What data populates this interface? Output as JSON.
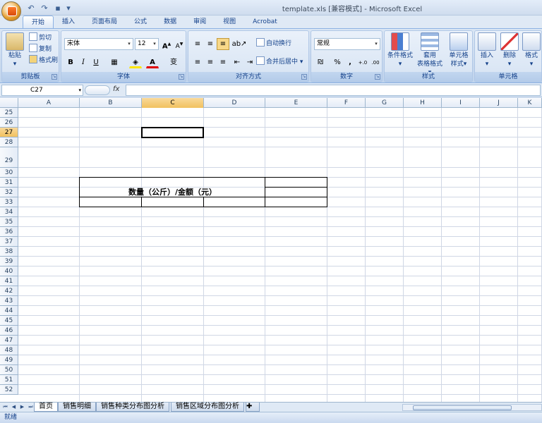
{
  "window": {
    "title": "template.xls  [兼容模式] - Microsoft Excel"
  },
  "qat": {
    "undo_icon": "undo-icon",
    "redo_icon": "redo-icon",
    "save_icon": "save-icon"
  },
  "tabs": [
    {
      "label": "开始",
      "active": true
    },
    {
      "label": "插入"
    },
    {
      "label": "页面布局"
    },
    {
      "label": "公式"
    },
    {
      "label": "数据"
    },
    {
      "label": "审阅"
    },
    {
      "label": "视图"
    },
    {
      "label": "Acrobat"
    }
  ],
  "ribbon": {
    "clipboard": {
      "label": "剪贴板",
      "paste": "粘贴",
      "cut": "剪切",
      "copy": "复制",
      "format_painter": "格式刷"
    },
    "font": {
      "label": "字体",
      "name": "宋体",
      "size": "12",
      "bold": "B",
      "italic": "I",
      "underline": "U",
      "phonetic": "变"
    },
    "alignment": {
      "label": "对齐方式",
      "wrap": "自动换行",
      "merge": "合并后居中"
    },
    "number": {
      "label": "数字",
      "format": "常规",
      "percent": "%",
      "comma": ",",
      "inc_decimal": "+.0",
      "dec_decimal": ".00"
    },
    "styles": {
      "label": "样式",
      "conditional": "条件格式",
      "table": "套用\n表格格式",
      "table1": "套用",
      "table2": "表格格式",
      "cell1": "单元格",
      "cell2": "样式"
    },
    "cells": {
      "label": "单元格",
      "insert": "插入",
      "delete": "删除",
      "format": "格式"
    }
  },
  "formula_bar": {
    "name_box": "C27",
    "fx": "fx",
    "value": ""
  },
  "columns": [
    "A",
    "B",
    "C",
    "D",
    "E",
    "F",
    "G",
    "H",
    "I",
    "J",
    "K"
  ],
  "rows": [
    "25",
    "26",
    "27",
    "28",
    "29",
    "30",
    "31",
    "32",
    "33",
    "34",
    "35",
    "36",
    "37",
    "38",
    "39",
    "40",
    "41",
    "42",
    "43",
    "44",
    "45",
    "46",
    "47",
    "48",
    "49",
    "50",
    "51",
    "52"
  ],
  "selected": {
    "column": "C",
    "row": "27"
  },
  "cells": {
    "merged_header": "数量（公斤）/金额（元）"
  },
  "sheets": [
    "首页",
    "销售明细",
    "销售种类分布图分析",
    "销售区域分布图分析"
  ],
  "active_sheet": "首页",
  "status": {
    "text": "就绪"
  }
}
